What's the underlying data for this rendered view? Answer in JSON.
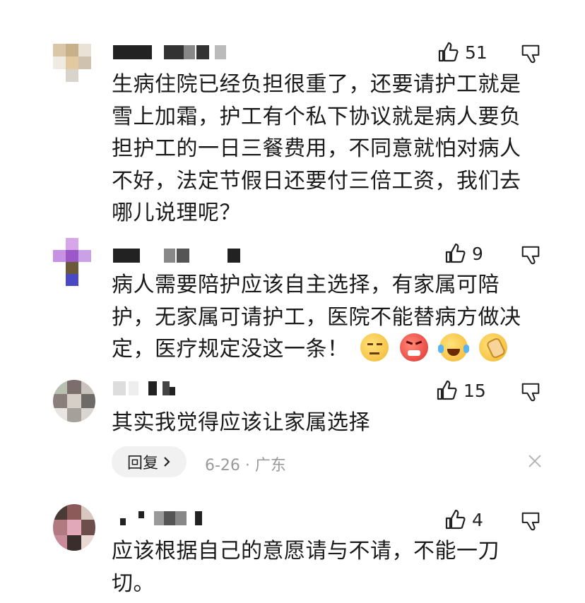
{
  "comments": [
    {
      "likes": "51",
      "text": "生病住院已经负担很重了，还要请护工就是雪上加霜，护工有个私下协议就是病人要负担护工的一日三餐费用，不同意就怕对病人不好，法定节假日还要付三倍工资，我们去哪儿说理呢？"
    },
    {
      "likes": "9",
      "text": "病人需要陪护应该自主选择，有家属可陪护，无家属可请护工，医院不能替病方做决定，医疗规定没这一条！",
      "emojis": [
        "thinking-emoji",
        "angry-emoji",
        "laughing-crying-emoji",
        "facepalm-emoji"
      ]
    },
    {
      "likes": "15",
      "text": "其实我觉得应该让家属选择",
      "reply_label": "回复",
      "meta": "6-26 · 广东"
    },
    {
      "likes": "4",
      "text": "应该根据自己的意愿请与不请，不能一刀切。"
    }
  ],
  "colors": {
    "text": "#1a1a1a",
    "meta": "#9a9a9a",
    "reply_bg": "#f1f1f1"
  }
}
